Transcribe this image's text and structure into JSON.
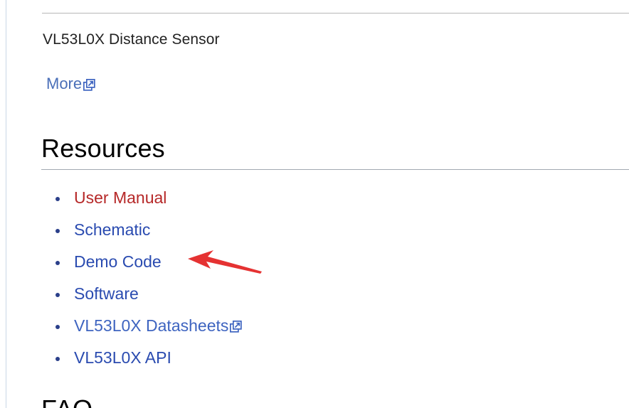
{
  "intro": {
    "description": "VL53L0X Distance Sensor",
    "more_label": "More"
  },
  "resources": {
    "heading": "Resources",
    "items": [
      {
        "label": "User Manual",
        "style": "red",
        "external": false
      },
      {
        "label": "Schematic",
        "style": "normal",
        "external": false
      },
      {
        "label": "Demo Code",
        "style": "normal",
        "external": false
      },
      {
        "label": "Software",
        "style": "normal",
        "external": false
      },
      {
        "label": "VL53L0X Datasheets",
        "style": "ext",
        "external": true
      },
      {
        "label": "VL53L0X API",
        "style": "normal",
        "external": false
      }
    ]
  },
  "next_section": {
    "heading_partial": "FAQ"
  },
  "colors": {
    "link": "#2a4bb0",
    "redlink": "#b62828",
    "annotation_arrow": "#e53232"
  },
  "icons": {
    "external_link": "external-link-icon",
    "annotation": "red-arrow-icon"
  }
}
